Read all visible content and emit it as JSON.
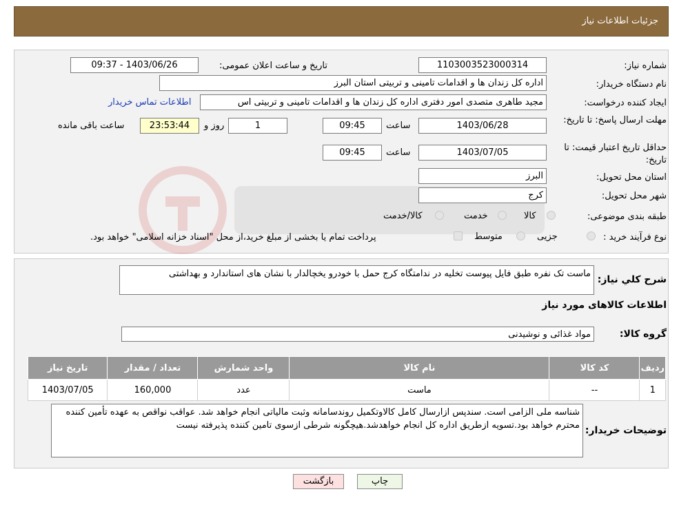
{
  "header": {
    "title": "جزئیات اطلاعات نیاز"
  },
  "form": {
    "need_number_label": "شماره نیاز:",
    "need_number": "1103003523000314",
    "announce_label": "تاریخ و ساعت اعلان عمومی:",
    "announce_value": "1403/06/26 - 09:37",
    "buyer_label": "نام دستگاه خریدار:",
    "buyer_value": "اداره کل زندان ها و اقدامات تامینی و تربیتی استان البرز",
    "creator_label": "ایجاد کننده درخواست:",
    "creator_value": "مجید طاهری متصدی امور دفتری اداره کل زندان ها و اقدامات تامینی و تربیتی اس",
    "contact_link": "اطلاعات تماس خریدار",
    "deadline_label": "مهلت ارسال پاسخ: تا تاریخ:",
    "deadline_date": "1403/06/28",
    "time_label": "ساعت",
    "deadline_time": "09:45",
    "days_value": "1",
    "days_label": "روز و",
    "remaining_value": "23:53:44",
    "remaining_label": "ساعت باقی مانده",
    "validity_label": "حداقل تاریخ اعتبار قیمت: تا تاریخ:",
    "validity_date": "1403/07/05",
    "validity_time": "09:45",
    "province_label": "استان محل تحویل:",
    "province_value": "البرز",
    "city_label": "شهر محل تحویل:",
    "city_value": "کرج",
    "category_label": "طبقه بندی موضوعی:",
    "category_options": [
      "کالا",
      "خدمت",
      "کالا/خدمت"
    ],
    "process_label": "نوع فرآیند خرید :",
    "process_options": [
      "جزیی",
      "متوسط"
    ],
    "process_note": "پرداخت تمام یا بخشی از مبلغ خرید،از محل \"اسناد خزانه اسلامی\" خواهد بود."
  },
  "description": {
    "label": "شرح کلي نياز:",
    "value": "ماست تک نفره طبق فایل پیوست تخلیه در ندامتگاه کرج حمل با خودرو یخچالدار با نشان های استاندارد و بهداشتی"
  },
  "goods": {
    "section_title": "اطلاعات کالاهای مورد نیاز",
    "group_label": "گروه کالا:",
    "group_value": "مواد غذائی و نوشیدنی",
    "columns": [
      "ردیف",
      "کد کالا",
      "نام کالا",
      "واحد شمارش",
      "تعداد / مقدار",
      "تاریخ نیاز"
    ],
    "rows": [
      [
        "1",
        "--",
        "ماست",
        "عدد",
        "160,000",
        "1403/07/05"
      ]
    ]
  },
  "buyer_notes": {
    "label": "توضیحات خریدار:",
    "value": "شناسه ملی الزامی است. سندپس ازارسال کامل کالاوتکمیل روندسامانه وثبت مالیاتی انجام خواهد شد. عواقب نواقص به عهده تأمین کننده محترم خواهد بود.تسویه ازطریق اداره کل انجام خواهدشد.هیچگونه شرطی ازسوی تامین کننده پذیرفته نیست"
  },
  "buttons": {
    "print": "چاپ",
    "back": "بازگشت"
  },
  "colors": {
    "header": "#8b6a3e",
    "link": "#1a3cb5",
    "table_header": "#9a9a9a",
    "back_button": "#fde0e0"
  }
}
